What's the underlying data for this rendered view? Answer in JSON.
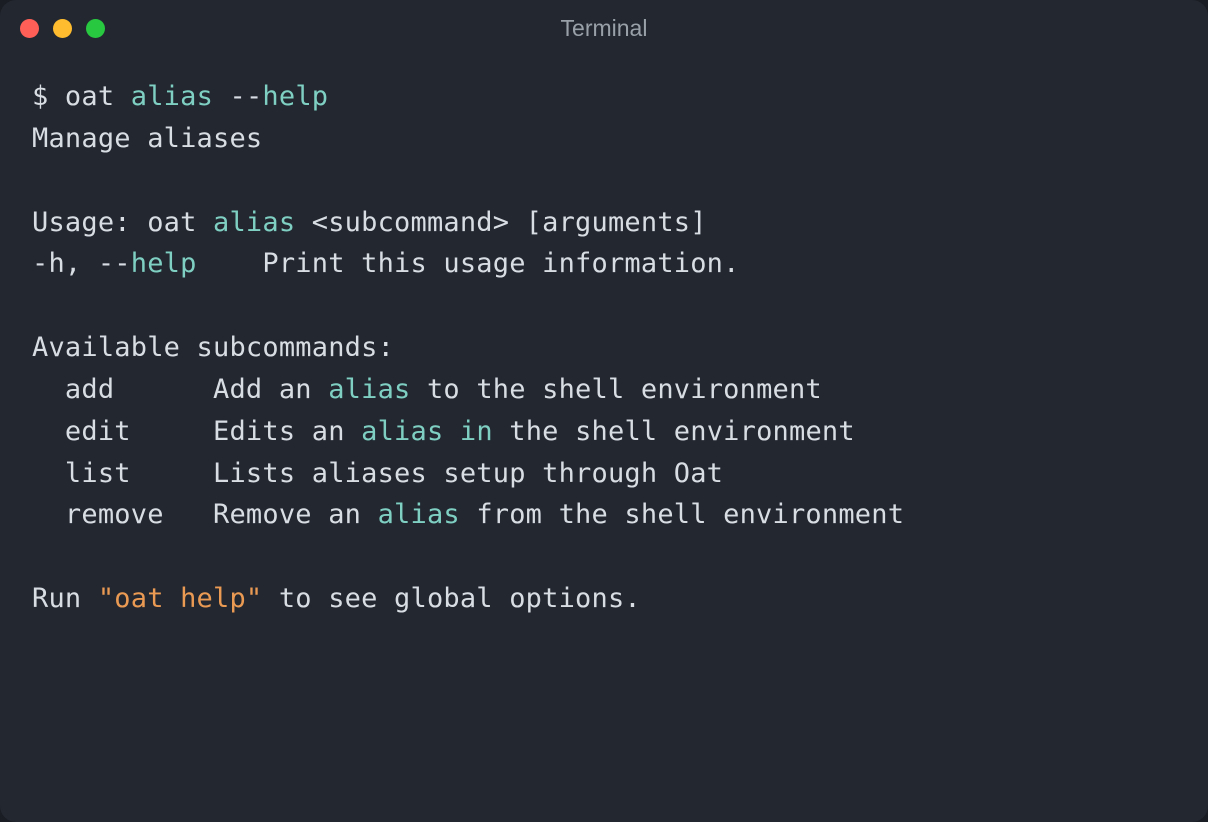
{
  "window": {
    "title": "Terminal"
  },
  "colors": {
    "teal": "#7fd0c3",
    "orange": "#ea9a53",
    "text": "#d8dde3",
    "bg": "#222730"
  },
  "prompt": "$ ",
  "command": {
    "bin": "oat ",
    "sub_hl": "alias",
    "flag_prefix": " --",
    "flag_hl": "help"
  },
  "description": "Manage aliases",
  "usage": {
    "prefix": "Usage: oat ",
    "sub_hl": "alias",
    "suffix": " <subcommand> [arguments]"
  },
  "help_flag": {
    "short": "-h, --",
    "hl": "help",
    "desc": "    Print this usage information."
  },
  "subcommands_header": "Available subcommands:",
  "subcommands": [
    {
      "name": "  add      ",
      "desc_pre": "Add an ",
      "hl1": "alias",
      "desc_mid": " to the shell environment",
      "hl2": "",
      "desc_post": ""
    },
    {
      "name": "  edit     ",
      "desc_pre": "Edits an ",
      "hl1": "alias",
      "desc_mid": " ",
      "hl2": "in",
      "desc_post": " the shell environment"
    },
    {
      "name": "  list     ",
      "desc_pre": "Lists aliases setup through Oat",
      "hl1": "",
      "desc_mid": "",
      "hl2": "",
      "desc_post": ""
    },
    {
      "name": "  remove   ",
      "desc_pre": "Remove an ",
      "hl1": "alias",
      "desc_mid": " from the shell environment",
      "hl2": "",
      "desc_post": ""
    }
  ],
  "footer": {
    "pre": "Run ",
    "quoted": "\"oat help\"",
    "post": " to see global options."
  }
}
